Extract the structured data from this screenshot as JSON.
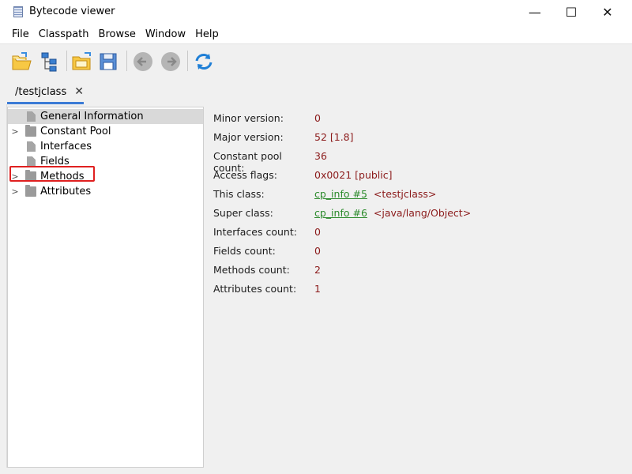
{
  "window": {
    "title": "Bytecode viewer",
    "minimize": "—",
    "maximize": "☐",
    "close": "✕"
  },
  "menu": [
    "File",
    "Classpath",
    "Browse",
    "Window",
    "Help"
  ],
  "toolbar": {
    "buttons": [
      "open-icon",
      "classpath-icon",
      "browse-icon",
      "save-icon",
      "back-icon",
      "forward-icon",
      "reload-icon"
    ]
  },
  "tab": {
    "label": "/testjclass",
    "close": "✕"
  },
  "tree": {
    "items": [
      {
        "label": "General Information",
        "type": "file",
        "expandable": false,
        "selected": true
      },
      {
        "label": "Constant Pool",
        "type": "folder",
        "expandable": true,
        "selected": false
      },
      {
        "label": "Interfaces",
        "type": "file",
        "expandable": false,
        "selected": false
      },
      {
        "label": "Fields",
        "type": "file",
        "expandable": false,
        "selected": false
      },
      {
        "label": "Methods",
        "type": "folder",
        "expandable": true,
        "selected": false
      },
      {
        "label": "Attributes",
        "type": "folder",
        "expandable": true,
        "selected": false
      }
    ],
    "chevron": ">"
  },
  "details": [
    {
      "key": "Minor version:",
      "value": "0"
    },
    {
      "key": "Major version:",
      "value": "52 [1.8]"
    },
    {
      "key": "Constant pool count:",
      "value": "36"
    },
    {
      "key": "Access flags:",
      "value": "0x0021 [public]"
    },
    {
      "key": "This class:",
      "link": "cp_info #5",
      "extra": "<testjclass>"
    },
    {
      "key": "Super class:",
      "link": "cp_info #6",
      "extra": "<java/lang/Object>"
    },
    {
      "key": "Interfaces count:",
      "value": "0"
    },
    {
      "key": "Fields count:",
      "value": "0"
    },
    {
      "key": "Methods count:",
      "value": "2"
    },
    {
      "key": "Attributes count:",
      "value": "1"
    }
  ],
  "colors": {
    "value": "#8b1a1a",
    "link": "#2b8a2b",
    "tabUnderline": "#3c7bd6",
    "annotation": "#e02020"
  }
}
